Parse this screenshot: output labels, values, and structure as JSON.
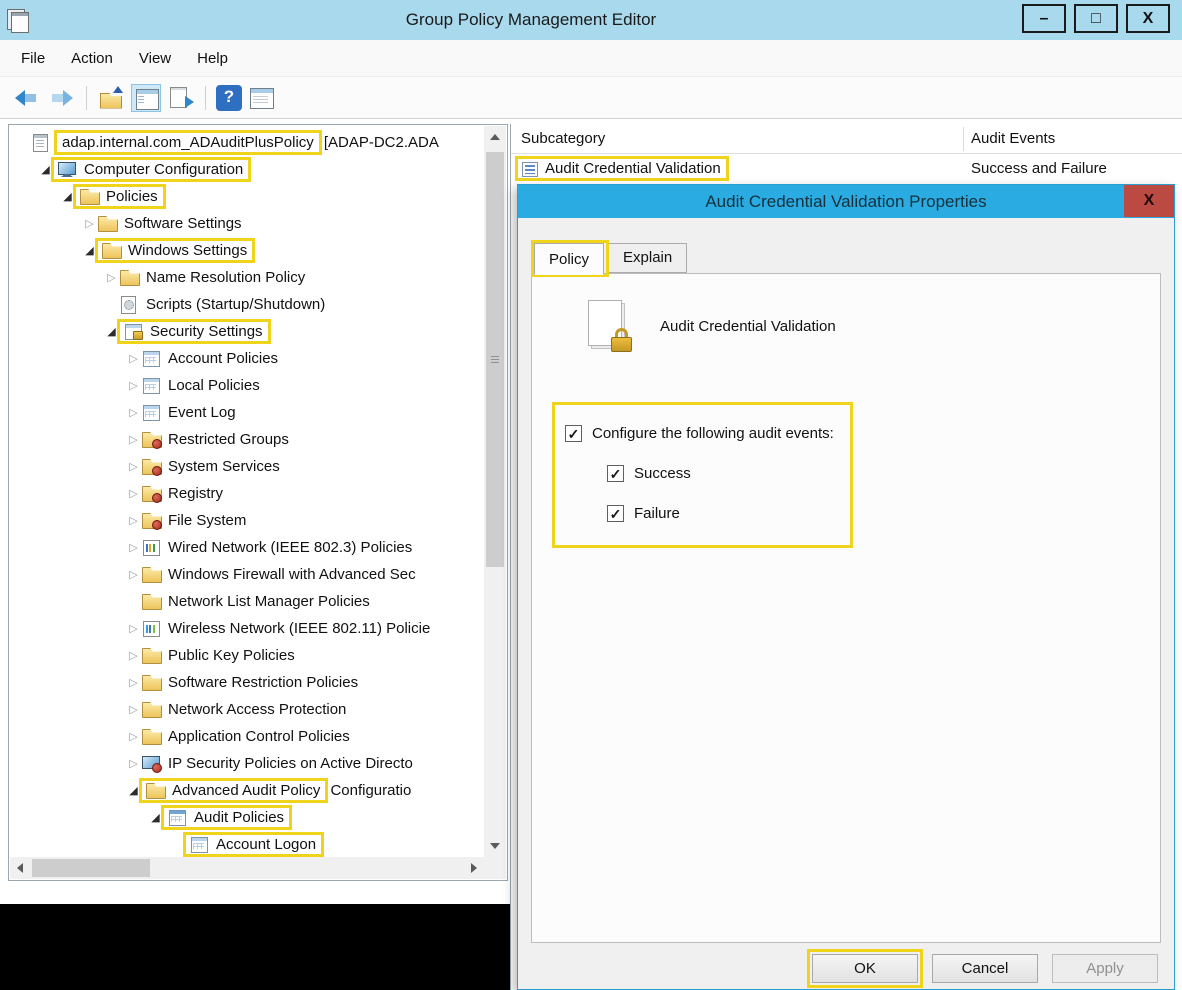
{
  "colors": {
    "highlight": "#f0d41b",
    "dialog_titlebar": "#2aabe2",
    "close_button": "#bb4a42",
    "window_titlebar": "#a9d9ec"
  },
  "window": {
    "title": "Group Policy Management Editor",
    "controls": {
      "minimize": "–",
      "maximize": "□",
      "close": "X"
    }
  },
  "menu": [
    "File",
    "Action",
    "View",
    "Help"
  ],
  "toolbar": [
    {
      "name": "back"
    },
    {
      "name": "forward"
    },
    {
      "separator": true
    },
    {
      "name": "up-one-level"
    },
    {
      "name": "show-console-tree",
      "pressed": true
    },
    {
      "name": "export-list"
    },
    {
      "separator": true
    },
    {
      "name": "help"
    },
    {
      "name": "properties"
    }
  ],
  "tree": {
    "items": [
      {
        "level": 0,
        "arrow": "none",
        "icon": "gpo",
        "hl": "adap.internal.com_ADAuditPlusPolicy",
        "post": " [ADAP-DC2.ADA",
        "hl_icon": false
      },
      {
        "level": 1,
        "arrow": "exp",
        "icon": "computer",
        "hl": "Computer Configuration",
        "hl_icon": true
      },
      {
        "level": 2,
        "arrow": "exp",
        "icon": "folder",
        "hl": "Policies",
        "hl_icon": true
      },
      {
        "level": 3,
        "arrow": "col",
        "icon": "folder",
        "pre": "Software Settings"
      },
      {
        "level": 3,
        "arrow": "exp",
        "icon": "folder",
        "hl": "Windows Settings",
        "hl_icon": true
      },
      {
        "level": 4,
        "arrow": "col",
        "icon": "folder",
        "pre": "Name Resolution Policy"
      },
      {
        "level": 4,
        "arrow": "none",
        "icon": "scripts",
        "pre": "Scripts (Startup/Shutdown)"
      },
      {
        "level": 4,
        "arrow": "exp",
        "icon": "security",
        "hl": "Security Settings",
        "hl_icon": true
      },
      {
        "level": 5,
        "arrow": "col",
        "icon": "grid",
        "pre": "Account Policies"
      },
      {
        "level": 5,
        "arrow": "col",
        "icon": "grid",
        "pre": "Local Policies"
      },
      {
        "level": 5,
        "arrow": "col",
        "icon": "grid",
        "pre": "Event Log"
      },
      {
        "level": 5,
        "arrow": "col",
        "icon": "lockfolder",
        "pre": "Restricted Groups"
      },
      {
        "level": 5,
        "arrow": "col",
        "icon": "lockfolder",
        "pre": "System Services"
      },
      {
        "level": 5,
        "arrow": "col",
        "icon": "lockfolder",
        "pre": "Registry"
      },
      {
        "level": 5,
        "arrow": "col",
        "icon": "lockfolder",
        "pre": "File System"
      },
      {
        "level": 5,
        "arrow": "col",
        "icon": "chart",
        "pre": "Wired Network (IEEE 802.3) Policies"
      },
      {
        "level": 5,
        "arrow": "col",
        "icon": "folder",
        "pre": "Windows Firewall with Advanced Sec"
      },
      {
        "level": 5,
        "arrow": "none",
        "icon": "folder",
        "pre": "Network List Manager Policies"
      },
      {
        "level": 5,
        "arrow": "col",
        "icon": "chart2",
        "pre": "Wireless Network (IEEE 802.11) Policie"
      },
      {
        "level": 5,
        "arrow": "col",
        "icon": "folder",
        "pre": "Public Key Policies"
      },
      {
        "level": 5,
        "arrow": "col",
        "icon": "folder",
        "pre": "Software Restriction Policies"
      },
      {
        "level": 5,
        "arrow": "col",
        "icon": "folder",
        "pre": "Network Access Protection"
      },
      {
        "level": 5,
        "arrow": "col",
        "icon": "folder",
        "pre": "Application Control Policies"
      },
      {
        "level": 5,
        "arrow": "col",
        "icon": "ipsec",
        "pre": "IP Security Policies on Active Directo"
      },
      {
        "level": 5,
        "arrow": "exp",
        "icon": "folder",
        "hl": "Advanced Audit Policy",
        "post": " Configuratio",
        "hl_icon": true
      },
      {
        "level": 6,
        "arrow": "exp",
        "icon": "audit",
        "hl": "Audit Policies",
        "hl_icon": true
      },
      {
        "level": 7,
        "arrow": "none",
        "icon": "grid",
        "hl": "Account Logon",
        "hl_icon": true
      }
    ]
  },
  "list": {
    "columns": [
      "Subcategory",
      "Audit Events"
    ],
    "rows": [
      {
        "icon": "binary",
        "subcategory": "Audit Credential Validation",
        "audit_events": "Success and Failure",
        "highlighted": true
      }
    ]
  },
  "dialog": {
    "title": "Audit Credential Validation Properties",
    "close_label": "X",
    "tabs": [
      {
        "label": "Policy",
        "active": true,
        "highlighted": true
      },
      {
        "label": "Explain",
        "active": false
      }
    ],
    "policy_name": "Audit Credential Validation",
    "options": [
      {
        "label": "Configure the following audit events:",
        "checked": true,
        "indent": 0
      },
      {
        "label": "Success",
        "checked": true,
        "indent": 1
      },
      {
        "label": "Failure",
        "checked": true,
        "indent": 1
      }
    ],
    "buttons": [
      {
        "label": "OK",
        "highlighted": true
      },
      {
        "label": "Cancel"
      },
      {
        "label": "Apply",
        "disabled": true
      }
    ]
  }
}
